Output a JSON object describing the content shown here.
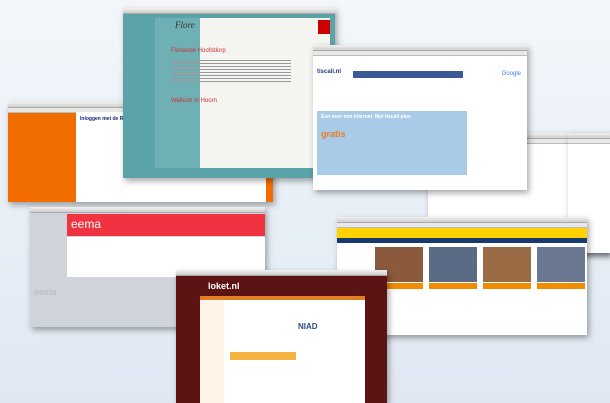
{
  "windows": {
    "flore": {
      "logo": "Flore",
      "heading": "Floriande Hoofddorp",
      "welcome": "Welkom in Hoorn"
    },
    "tiscali": {
      "logo": "tiscali.nl",
      "banner_heading": "Een neer met internet. Met tiscali plus",
      "banner_offer": "gratis",
      "search_brand": "Google"
    },
    "orange": {
      "heading": "Inloggen met de Rotterdam G"
    },
    "eema": {
      "brand": "eema",
      "watermark": "eema"
    },
    "loket": {
      "title": "loket.nl",
      "partner": "NIAD"
    }
  }
}
